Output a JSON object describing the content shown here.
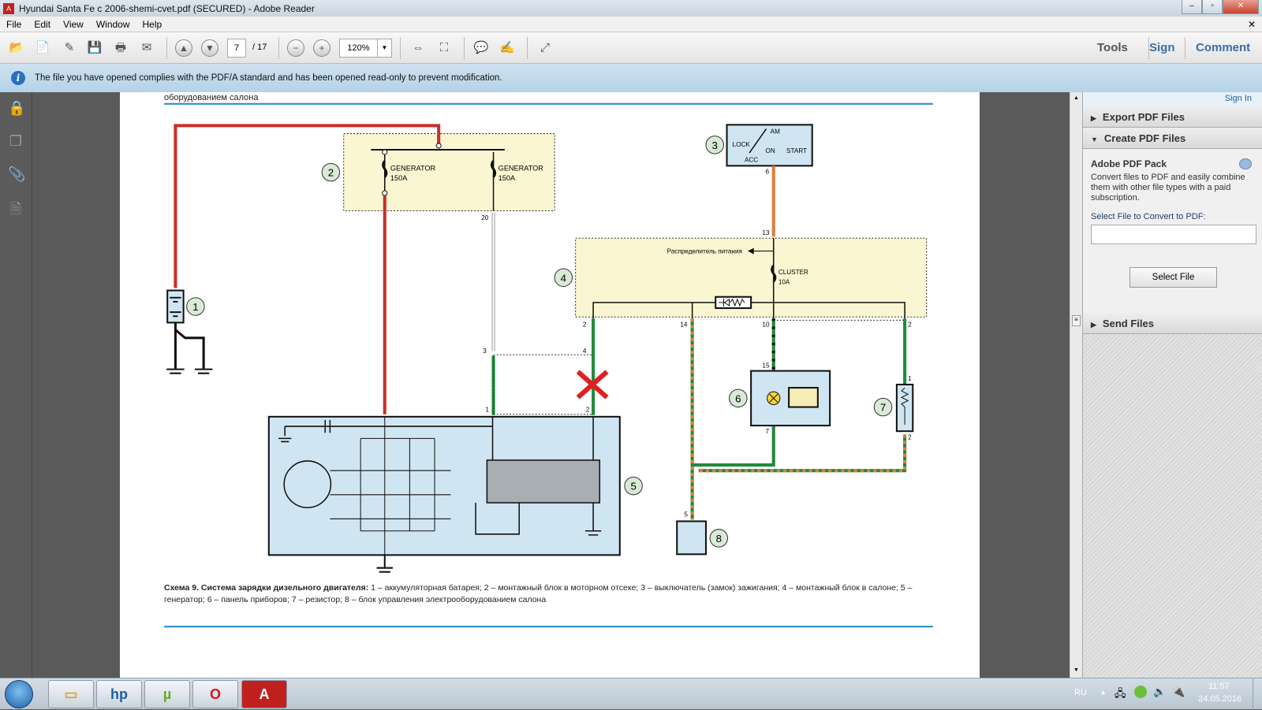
{
  "window": {
    "title": "Hyundai Santa Fe c 2006-shemi-cvet.pdf (SECURED) - Adobe Reader",
    "minimize": "–",
    "maximize": "▫",
    "close": "✕",
    "doc_close": "✕"
  },
  "menu": [
    "File",
    "Edit",
    "View",
    "Window",
    "Help"
  ],
  "toolbar": {
    "page_current": "7",
    "page_total": "/ 17",
    "zoom": "120%",
    "tools": "Tools",
    "sign": "Sign",
    "comment": "Comment"
  },
  "infobar": {
    "message": "The file you have opened complies with the PDF/A standard and has been opened read-only to prevent modification."
  },
  "right_panel": {
    "sign_in": "Sign In",
    "export": "Export PDF Files",
    "create": "Create PDF Files",
    "pack_title": "Adobe PDF Pack",
    "pack_desc": "Convert files to PDF and easily combine them with other file types with a paid subscription.",
    "select_label": "Select File to Convert to PDF:",
    "select_value": "",
    "select_button": "Select File",
    "send": "Send Files"
  },
  "document": {
    "header_fragment": "оборудованием салона",
    "callouts": [
      "1",
      "2",
      "3",
      "4",
      "5",
      "6",
      "7",
      "8"
    ],
    "labels": {
      "gen1": "GENERATOR",
      "gen1a": "150A",
      "gen2": "GENERATOR",
      "gen2a": "150A",
      "am": "AM",
      "lock": "LOCK",
      "on": "ON",
      "start": "START",
      "acc": "ACC",
      "distributor": "Распределитель питания",
      "cluster": "CLUSTER",
      "cluster_a": "10A"
    },
    "pins": {
      "p20": "20",
      "p3": "3",
      "p1": "1",
      "p4": "4",
      "p2a": "2",
      "p6": "6",
      "p13": "13",
      "p2b": "2",
      "p14": "14",
      "p10": "10",
      "p2c": "2",
      "p15": "15",
      "p7": "7",
      "p1b": "1",
      "p2d": "2",
      "p5": "5"
    },
    "caption_bold": "Схема 9. Система зарядки дизельного двигателя:",
    "caption_text": " 1 – аккумуляторная батарея; 2 – монтажный блок в моторном отсеке; 3 – выключатель (замок) зажигания; 4 – монтажный блок в салоне; 5 – генератор; 6 – панель приборов; 7 – резистор; 8 – блок управления электрооборудованием салона",
    "colors": {
      "red": "#c8302c",
      "green": "#1f8a3c",
      "orange": "#d9803e",
      "box_blue": "#cfe6f2",
      "box_yellow": "#fbf6d2",
      "callout": "#d9ead6",
      "rule": "#2a8fc4"
    }
  },
  "taskbar": {
    "lang": "RU",
    "time": "11:57",
    "date": "24.05.2016",
    "apps": [
      "start-orb",
      "explorer",
      "hp",
      "utorrent",
      "opera",
      "adobe-reader"
    ]
  }
}
